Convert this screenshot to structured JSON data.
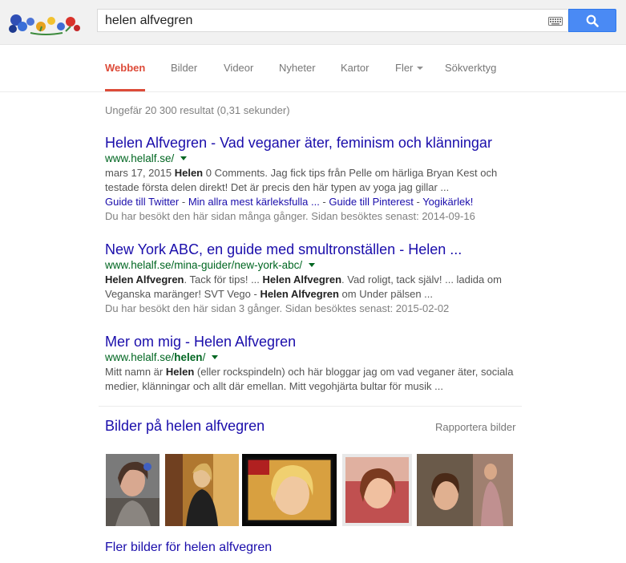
{
  "search": {
    "query": "helen alfvegren"
  },
  "tabs": [
    {
      "label": "Webben"
    },
    {
      "label": "Bilder"
    },
    {
      "label": "Videor"
    },
    {
      "label": "Nyheter"
    },
    {
      "label": "Kartor"
    },
    {
      "label": "Fler"
    },
    {
      "label": "Sökverktyg"
    }
  ],
  "stats": "Ungefär 20 300 resultat (0,31 sekunder)",
  "results": [
    {
      "title": "Helen Alfvegren - Vad veganer äter, feminism och klänningar",
      "url": "www.helalf.se/",
      "snippet_line1_a": "mars 17, 2015 ",
      "snippet_line1_b": "Helen",
      "snippet_line1_c": " 0 Comments. Jag fick tips från Pelle om härliga Bryan Kest och",
      "snippet_line2": "testade första delen direkt! Det är precis den här typen av yoga jag gillar ...",
      "sitelinks": [
        "Guide till Twitter",
        "Min allra mest kärleksfulla ...",
        "Guide till Pinterest",
        "Yogikärlek!"
      ],
      "visited": "Du har besökt den här sidan många gånger. Sidan besöktes senast: 2014-09-16"
    },
    {
      "title": "New York ABC, en guide med smultronställen - Helen ...",
      "url": "www.helalf.se/mina-guider/new-york-abc/",
      "s1a": "Helen Alfvegren",
      "s1b": ". Tack för tips! ... ",
      "s1c": "Helen Alfvegren",
      "s1d": ". Vad roligt, tack själv! ... ladida om",
      "s2a": "Veganska maränger! SVT Vego - ",
      "s2b": "Helen Alfvegren",
      "s2c": " om Under pälsen ...",
      "visited": "Du har besökt den här sidan 3 gånger. Sidan besöktes senast: 2015-02-02"
    },
    {
      "title": "Mer om mig - Helen Alfvegren",
      "url_a": "www.helalf.se/",
      "url_b": "helen",
      "url_c": "/",
      "s1a": "Mitt namn är ",
      "s1b": "Helen",
      "s1c": " (eller rockspindeln) och här bloggar jag om vad veganer äter, sociala",
      "s2": "medier, klänningar och allt där emellan. Mitt vegohjärta bultar för musik ..."
    }
  ],
  "images": {
    "heading": "Bilder på helen alfvegren",
    "report": "Rapportera bilder",
    "more": "Fler bilder för helen alfvegren"
  },
  "icons": {
    "logo": "flower-doodle-logo",
    "keyboard": "keyboard-icon",
    "search": "magnifier-icon"
  },
  "colors": {
    "link": "#1a0dab",
    "url": "#006621",
    "active_tab": "#dd4b39",
    "search_button": "#4a8af4"
  }
}
